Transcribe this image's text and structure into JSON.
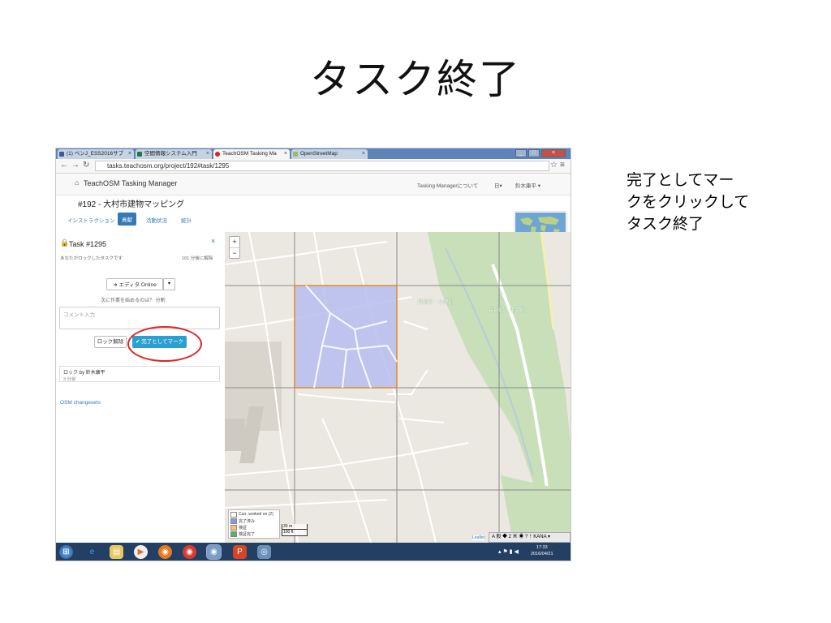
{
  "slide": {
    "title": "タスク終了",
    "note": "完了としてマー\nクをクリックして\nタスク終了"
  },
  "browser": {
    "tabs": [
      {
        "label": "(1) ベンJ_ESS2016サブ",
        "active": false,
        "color": "#3b5998"
      },
      {
        "label": "空間情報システム入門",
        "active": false,
        "color": "#1e7a44"
      },
      {
        "label": "TeachOSM Tasking Ma",
        "active": true,
        "color": "#d9251c"
      },
      {
        "label": "OpenStreetMap",
        "active": false,
        "color": "#9bbd5c"
      }
    ],
    "url": "tasks.teachosm.org/project/192#task/1295"
  },
  "app": {
    "brand": "TeachOSM Tasking Manager",
    "nav_about": "Tasking Managerについて",
    "nav_lang": "日▾",
    "nav_user": "鈴木康平 ▾",
    "project_title": "#192 - 大村市建物マッピング",
    "project_tabs": [
      "インストラクション",
      "貢献",
      "活動状況",
      "統計"
    ]
  },
  "task_panel": {
    "title": "Task #1295",
    "close": "×",
    "lock_info": "あなたがロックしたタスクです",
    "time_left": "101 分後に解除",
    "editor_button": "➜ エディタ Online",
    "caret": "▾",
    "question": "次に作業を始めるのは？ 分割 ",
    "comment_placeholder": "コメント入力",
    "unlock_button": "ロック解除",
    "done_button": "✔ 完了としてマーク",
    "history_line1": "ロック by 鈴木康平",
    "history_line2": "3 分前",
    "osm_changesets": "OSM changesets"
  },
  "map": {
    "zoom_in": "+",
    "zoom_out": "−",
    "legend": [
      {
        "label": "Curr. worked on (2)",
        "color": "#ffffff"
      },
      {
        "label": "完了済み",
        "color": "#8d95e8"
      },
      {
        "label": "検証",
        "color": "#f3c66c"
      },
      {
        "label": "検証完了",
        "color": "#5cae5c"
      }
    ],
    "scale_m": "30 m",
    "scale_ft": "100 ft",
    "attribution": "Leaflet",
    "place_labels": [
      "長岡町・小路町",
      "長岡町・小路町"
    ],
    "selected_color": "#b7bdf0"
  },
  "taskbar": {
    "ime": "A 般 ◆ 2 ▣ ◉ ? ᚠ KANA ▾",
    "time": "17:33",
    "date": "2016/04/21"
  }
}
